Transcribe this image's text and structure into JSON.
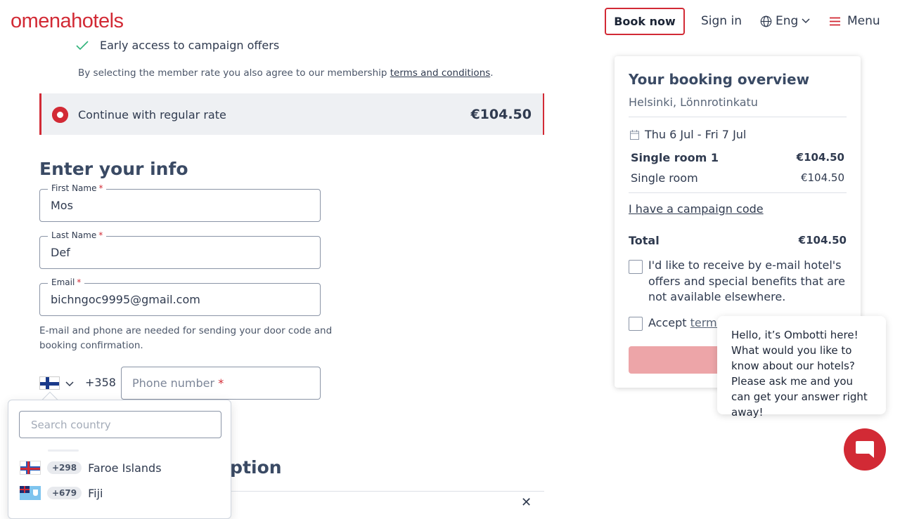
{
  "header": {
    "logo": "omenahotels",
    "book_now": "Book now",
    "sign_in": "Sign in",
    "language": "Eng",
    "menu": "Menu"
  },
  "membership": {
    "benefit": "Early access to campaign offers",
    "terms_prefix": "By selecting the member rate you also agree to our membership ",
    "terms_link": "terms and conditions",
    "terms_suffix": "."
  },
  "rate": {
    "label": "Continue with regular rate",
    "price": "€104.50"
  },
  "form": {
    "title": "Enter your info",
    "first_name": {
      "label": "First Name",
      "value": "Mos"
    },
    "last_name": {
      "label": "Last Name",
      "value": "Def"
    },
    "email": {
      "label": "Email",
      "value": "bichngoc9995@gmail.com"
    },
    "required_mark": "*",
    "helper": "E-mail and phone are needed for sending your door code and booking confirmation.",
    "dial_code": "+358",
    "phone_placeholder": "Phone number"
  },
  "country_dropdown": {
    "search_placeholder": "Search country",
    "countries": [
      {
        "code": "+298",
        "name": "Faroe Islands"
      },
      {
        "code": "+679",
        "name": "Fiji"
      }
    ]
  },
  "background_section": {
    "title_fragment": "option"
  },
  "overview": {
    "title": "Your booking overview",
    "location": "Helsinki, Lönnrotinkatu",
    "dates": "Thu 6 Jul - Fri 7 Jul",
    "room_heading": "Single room 1",
    "room_heading_price": "€104.50",
    "room_type": "Single room",
    "room_type_price": "€104.50",
    "campaign_link": "I have a campaign code",
    "total_label": "Total",
    "total_price": "€104.50",
    "offers_checkbox": "I'd like to receive by e-mail hotel's offers and special benefits that are not available elsewhere.",
    "accept_prefix": "Accept ",
    "accept_link": "terms"
  },
  "chat": {
    "message": "Hello, it’s Ombotti here! What would you like to know about our hotels? Please ask me and you can get your answer right away!"
  },
  "colors": {
    "brand_red": "#d22a35",
    "text": "#2f3a4f",
    "check_green": "#2fb37a"
  }
}
